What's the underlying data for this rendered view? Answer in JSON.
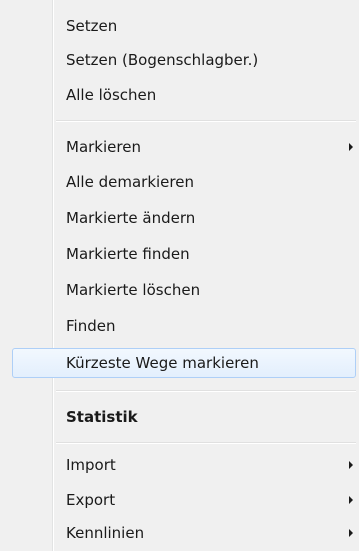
{
  "menu": {
    "items": [
      {
        "label": "Setzen"
      },
      {
        "label": "Setzen (Bogenschlagber.)"
      },
      {
        "label": "Alle löschen"
      },
      {
        "label": "Markieren",
        "submenu": true
      },
      {
        "label": "Alle demarkieren"
      },
      {
        "label": "Markierte ändern"
      },
      {
        "label": "Markierte finden"
      },
      {
        "label": "Markierte löschen"
      },
      {
        "label": "Finden"
      },
      {
        "label": "Kürzeste Wege markieren",
        "highlighted": true
      },
      {
        "label": "Statistik",
        "bold": true
      },
      {
        "label": "Import",
        "submenu": true
      },
      {
        "label": "Export",
        "submenu": true
      },
      {
        "label": "Kennlinien",
        "submenu": true
      }
    ]
  }
}
